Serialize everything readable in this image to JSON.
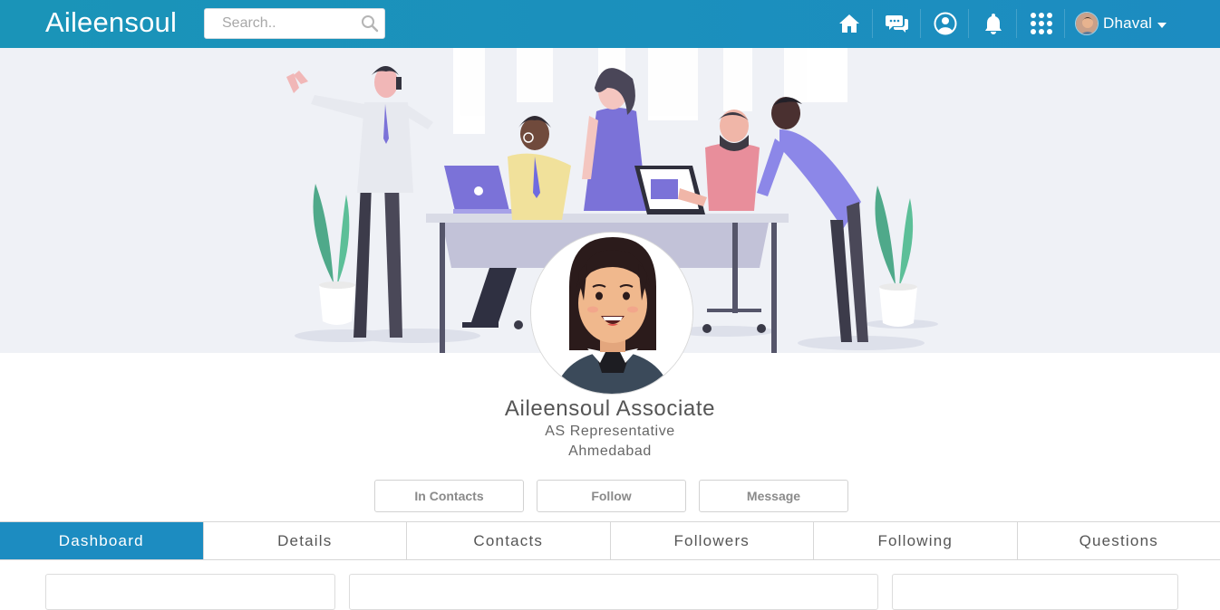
{
  "header": {
    "brand": "Aileensoul",
    "search_placeholder": "Search..",
    "user_name": "Dhaval",
    "icons": [
      "home-icon",
      "messages-icon",
      "profile-icon",
      "notifications-icon",
      "apps-grid-icon"
    ]
  },
  "profile": {
    "name": "Aileensoul Associate",
    "title": "AS Representative",
    "location": "Ahmedabad"
  },
  "actions": {
    "contacts_label": "In Contacts",
    "follow_label": "Follow",
    "message_label": "Message"
  },
  "tabs": [
    {
      "label": "Dashboard"
    },
    {
      "label": "Details"
    },
    {
      "label": "Contacts"
    },
    {
      "label": "Followers"
    },
    {
      "label": "Following"
    },
    {
      "label": "Questions"
    }
  ],
  "colors": {
    "header": "#1c8cc1",
    "active_tab": "#1c8cc1",
    "cover_bg": "#eff1f6"
  }
}
